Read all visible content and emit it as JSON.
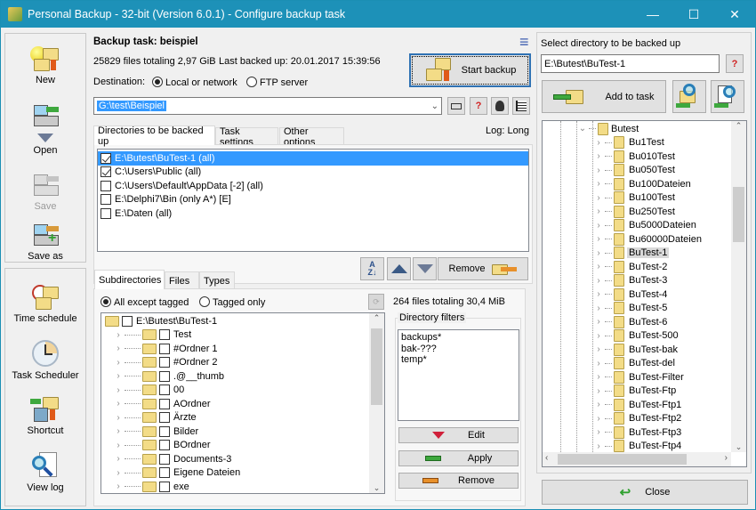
{
  "window": {
    "title": "Personal Backup - 32-bit (Version 6.0.1) - Configure backup task",
    "controls": {
      "minimize": "—",
      "maximize": "☐",
      "close": "✕"
    }
  },
  "sidebar_top": [
    {
      "label": "New",
      "icon": "new-task-icon",
      "enabled": true
    },
    {
      "label": "Open",
      "icon": "open-task-icon",
      "enabled": true
    },
    {
      "label": "Save",
      "icon": "save-task-icon",
      "enabled": false
    },
    {
      "label": "Save as",
      "icon": "save-as-icon",
      "enabled": true
    }
  ],
  "sidebar_bottom": [
    {
      "label": "Time schedule",
      "icon": "time-schedule-icon"
    },
    {
      "label": "Task Scheduler",
      "icon": "clock-icon"
    },
    {
      "label": "Shortcut",
      "icon": "shortcut-icon"
    },
    {
      "label": "View log",
      "icon": "view-log-icon"
    }
  ],
  "task": {
    "title": "Backup task: beispiel",
    "summary": "25829 files totaling 2,97 GiB",
    "last_backed_up": "Last backed up:  20.01.2017 15:39:56",
    "destination_label": "Destination:",
    "dest_options": [
      "Local or network",
      "FTP server"
    ],
    "dest_selected": "Local or network",
    "path": "G:\\test\\Beispiel",
    "start_backup": "Start backup",
    "menu_icon": "≡"
  },
  "tabs": [
    "Directories to be backed up",
    "Task settings",
    "Other options"
  ],
  "active_tab": "Directories to be backed up",
  "log_label": "Log: Long",
  "directories": [
    {
      "path": "E:\\Butest\\BuTest-1 (all)",
      "checked": true,
      "selected": true
    },
    {
      "path": "C:\\Users\\Public (all)",
      "checked": true,
      "selected": false
    },
    {
      "path": "C:\\Users\\Default\\AppData [-2] (all)",
      "checked": false,
      "selected": false
    },
    {
      "path": "E:\\Delphi7\\Bin (only A*) [E]",
      "checked": false,
      "selected": false
    },
    {
      "path": "E:\\Daten (all)",
      "checked": false,
      "selected": false
    }
  ],
  "list_buttons": {
    "remove": "Remove"
  },
  "sub_tabs": [
    "Subdirectories",
    "Files",
    "Types"
  ],
  "active_sub_tab": "Subdirectories",
  "sub_mode": {
    "options": [
      "All except tagged",
      "Tagged only"
    ],
    "selected": "All except tagged"
  },
  "sub_summary": "264 files totaling 30,4 MiB",
  "subtree": {
    "root": "E:\\Butest\\BuTest-1",
    "children": [
      " Test",
      "#Ordner 1",
      "#Ordner 2",
      ".@__thumb",
      "00",
      "AOrdner",
      "Ärzte",
      "Bilder",
      "BOrdner",
      "Documents-3",
      "Eigene Dateien",
      "exe"
    ]
  },
  "dir_filters": {
    "title": "Directory filters",
    "items": [
      "backups*",
      "bak-???",
      "temp*"
    ],
    "edit": "Edit",
    "apply": "Apply",
    "remove": "Remove"
  },
  "right": {
    "label": "Select directory to be backed up",
    "path": "E:\\Butest\\BuTest-1",
    "add_to_task": "Add to task",
    "tree_root": "Butest",
    "tree_items": [
      "Bu1Test",
      "Bu010Test",
      "Bu050Test",
      "Bu100Dateien",
      "Bu100Test",
      "Bu250Test",
      "Bu5000Dateien",
      "Bu60000Dateien",
      "BuTest-1",
      "BuTest-2",
      "BuTest-3",
      "BuTest-4",
      "BuTest-5",
      "BuTest-6",
      "BuTest-500",
      "BuTest-bak",
      "BuTest-del",
      "BuTest-Filter",
      "BuTest-Ftp",
      "BuTest-Ftp1",
      "BuTest-Ftp2",
      "BuTest-Ftp3",
      "BuTest-Ftp4"
    ],
    "tree_selected": "BuTest-1",
    "close": "Close"
  },
  "colors": {
    "titlebar": "#1d91b8",
    "selection": "#3399ff",
    "folder": "#f3dc87"
  }
}
